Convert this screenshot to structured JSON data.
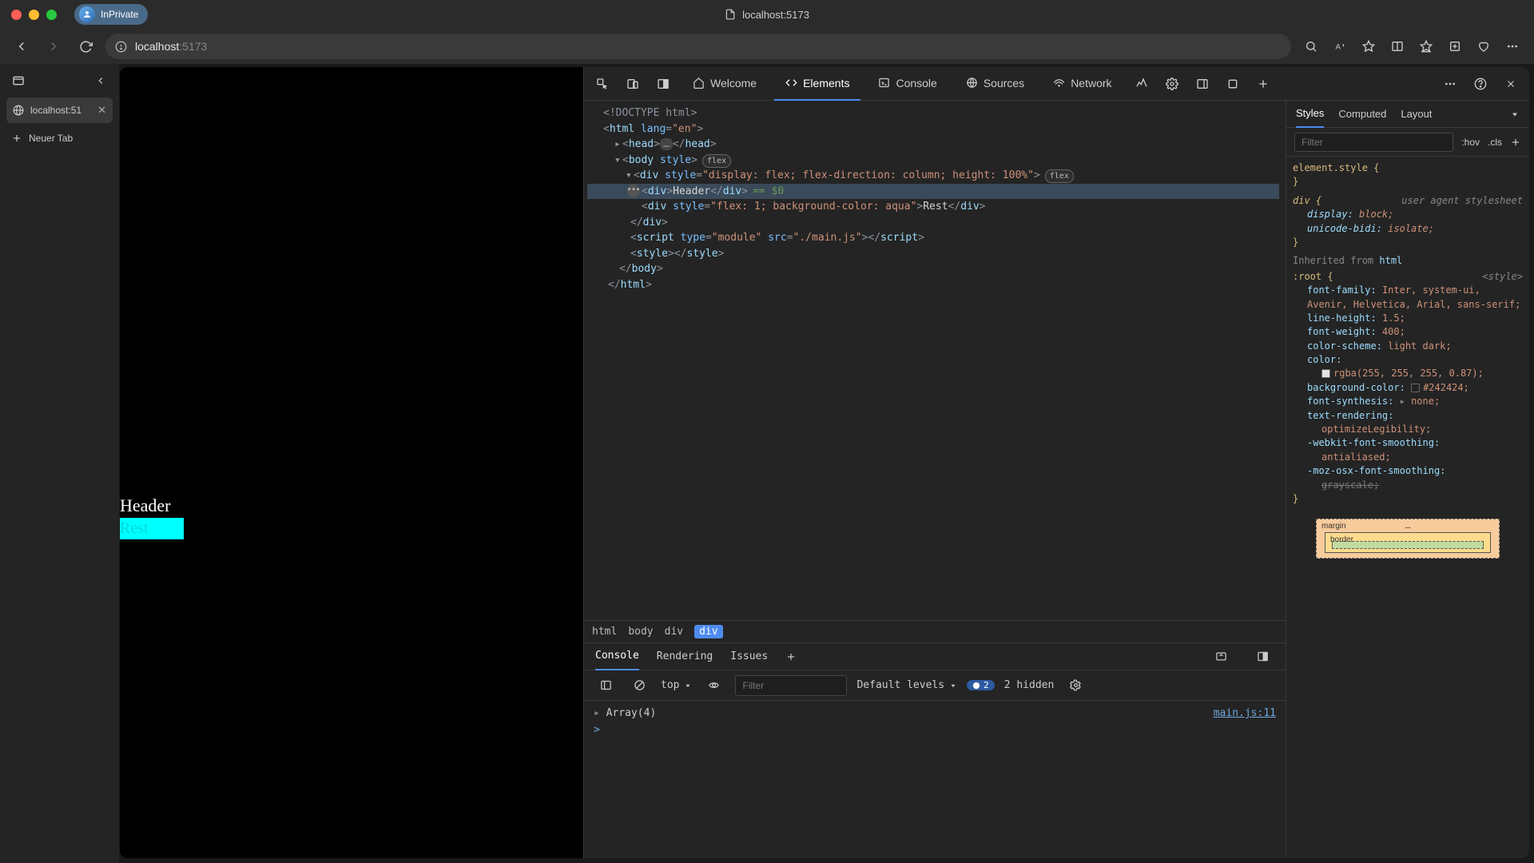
{
  "titlebar": {
    "inprivate": "InPrivate",
    "page_title": "localhost:5173"
  },
  "toolbar": {
    "url_host": "localhost",
    "url_path": ":5173"
  },
  "left_pane": {
    "tab_label": "localhost:51",
    "new_tab": "Neuer Tab"
  },
  "rendered": {
    "header": "Header",
    "rest": "Rest"
  },
  "devtools": {
    "tabs": {
      "welcome": "Welcome",
      "elements": "Elements",
      "console": "Console",
      "sources": "Sources",
      "network": "Network"
    },
    "dom": {
      "l1": "<!DOCTYPE html>",
      "l2_open": "<",
      "l2_tag": "html",
      "l2_attr": " lang",
      "l2_eq": "=",
      "l2_val": "\"en\"",
      "l2_close": ">",
      "l3_head_open": "<head>",
      "l3_head_dots": "…",
      "l3_head_close": "</head>",
      "l4_body_open": "<body ",
      "l4_body_attr": "style",
      "l4_body_close": ">",
      "l4_flex": "flex",
      "l5_div_open": "<div ",
      "l5_attr": "style",
      "l5_val": "\"display: flex; flex-direction: column; height: 100%\"",
      "l5_close": ">",
      "l5_flex": "flex",
      "l6_open": "<div>",
      "l6_text": "Header",
      "l6_close": "</div>",
      "l6_eq0": "== $0",
      "l7_open": "<div ",
      "l7_attr": "style",
      "l7_val": "\"flex: 1; background-color: aqua\"",
      "l7_close": ">",
      "l7_text": "Rest",
      "l7_end": "</div>",
      "l8": "</div>",
      "l9_open": "<script ",
      "l9_attr1": "type",
      "l9_val1": "\"module\"",
      "l9_attr2": "src",
      "l9_val2": "\"./main.js\"",
      "l9_close": "></script>",
      "l10_open": "<style>",
      "l10_close": "</style>",
      "l11": "</body>",
      "l12": "</html>"
    },
    "breadcrumb": [
      "html",
      "body",
      "div",
      "div"
    ],
    "styles": {
      "tabs": {
        "styles": "Styles",
        "computed": "Computed",
        "layout": "Layout"
      },
      "filter_placeholder": "Filter",
      "hov": ":hov",
      "cls": ".cls",
      "element_style": "element.style {",
      "brace_close": "}",
      "div_sel": "div {",
      "ua": "user agent stylesheet",
      "p_display": "display:",
      "v_display": "block;",
      "p_bidi": "unicode-bidi:",
      "v_bidi": "isolate;",
      "inherited": "Inherited from ",
      "inherited_tag": "html",
      "root_sel": ":root {",
      "root_src": "<style>",
      "p_ff": "font-family:",
      "v_ff": "Inter, system-ui, Avenir, Helvetica, Arial, sans-serif;",
      "p_lh": "line-height:",
      "v_lh": "1.5;",
      "p_fw": "font-weight:",
      "v_fw": "400;",
      "p_cs": "color-scheme:",
      "v_cs": "light dark;",
      "p_col": "color:",
      "v_col": "rgba(255, 255, 255, 0.87);",
      "p_bg": "background-color:",
      "v_bg": "#242424;",
      "p_fs": "font-synthesis:",
      "v_fs": "none;",
      "p_tr": "text-rendering:",
      "v_tr": "optimizeLegibility;",
      "p_wfs": "-webkit-font-smoothing:",
      "v_wfs": "antialiased;",
      "p_mfs": "-moz-osx-font-smoothing:",
      "v_mfs": "grayscale;",
      "bm_margin": "margin",
      "bm_border": "border",
      "bm_dash": "–"
    },
    "drawer": {
      "tabs": {
        "console": "Console",
        "rendering": "Rendering",
        "issues": "Issues"
      },
      "context": "top",
      "filter_placeholder": "Filter",
      "levels": "Default levels",
      "msg_count": "2",
      "hidden": "2 hidden",
      "log_text": "Array(4)",
      "log_loc": "main.js:11",
      "prompt": ">"
    }
  }
}
